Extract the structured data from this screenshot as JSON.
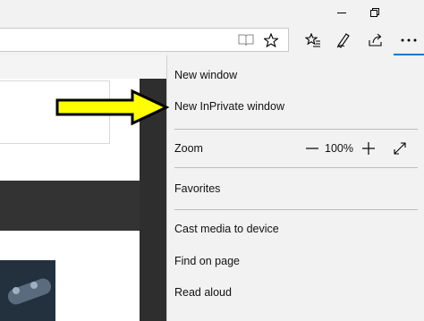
{
  "window_controls": {
    "minimize_icon": "minimize-icon",
    "restore_icon": "restore-icon"
  },
  "toolbar": {
    "reading_view_icon": "reading-view-icon",
    "favorite_star_icon": "star-icon",
    "favorites_hub_icon": "favorites-hub-icon",
    "notes_icon": "pen-icon",
    "share_icon": "share-icon",
    "more_icon": "more-dots-icon",
    "accent_color": "#0078d7"
  },
  "menu": {
    "items": [
      {
        "label": "New window"
      },
      {
        "label": "New InPrivate window"
      },
      {
        "label": "Zoom"
      },
      {
        "label": "Favorites"
      },
      {
        "label": "Cast media to device"
      },
      {
        "label": "Find on page"
      },
      {
        "label": "Read aloud"
      }
    ],
    "zoom": {
      "value": "100%",
      "minus_icon": "zoom-out-icon",
      "plus_icon": "zoom-in-icon",
      "fullscreen_icon": "fullscreen-icon"
    }
  },
  "annotation": {
    "arrow_color": "#ffff00",
    "arrow_outline": "#000000"
  }
}
